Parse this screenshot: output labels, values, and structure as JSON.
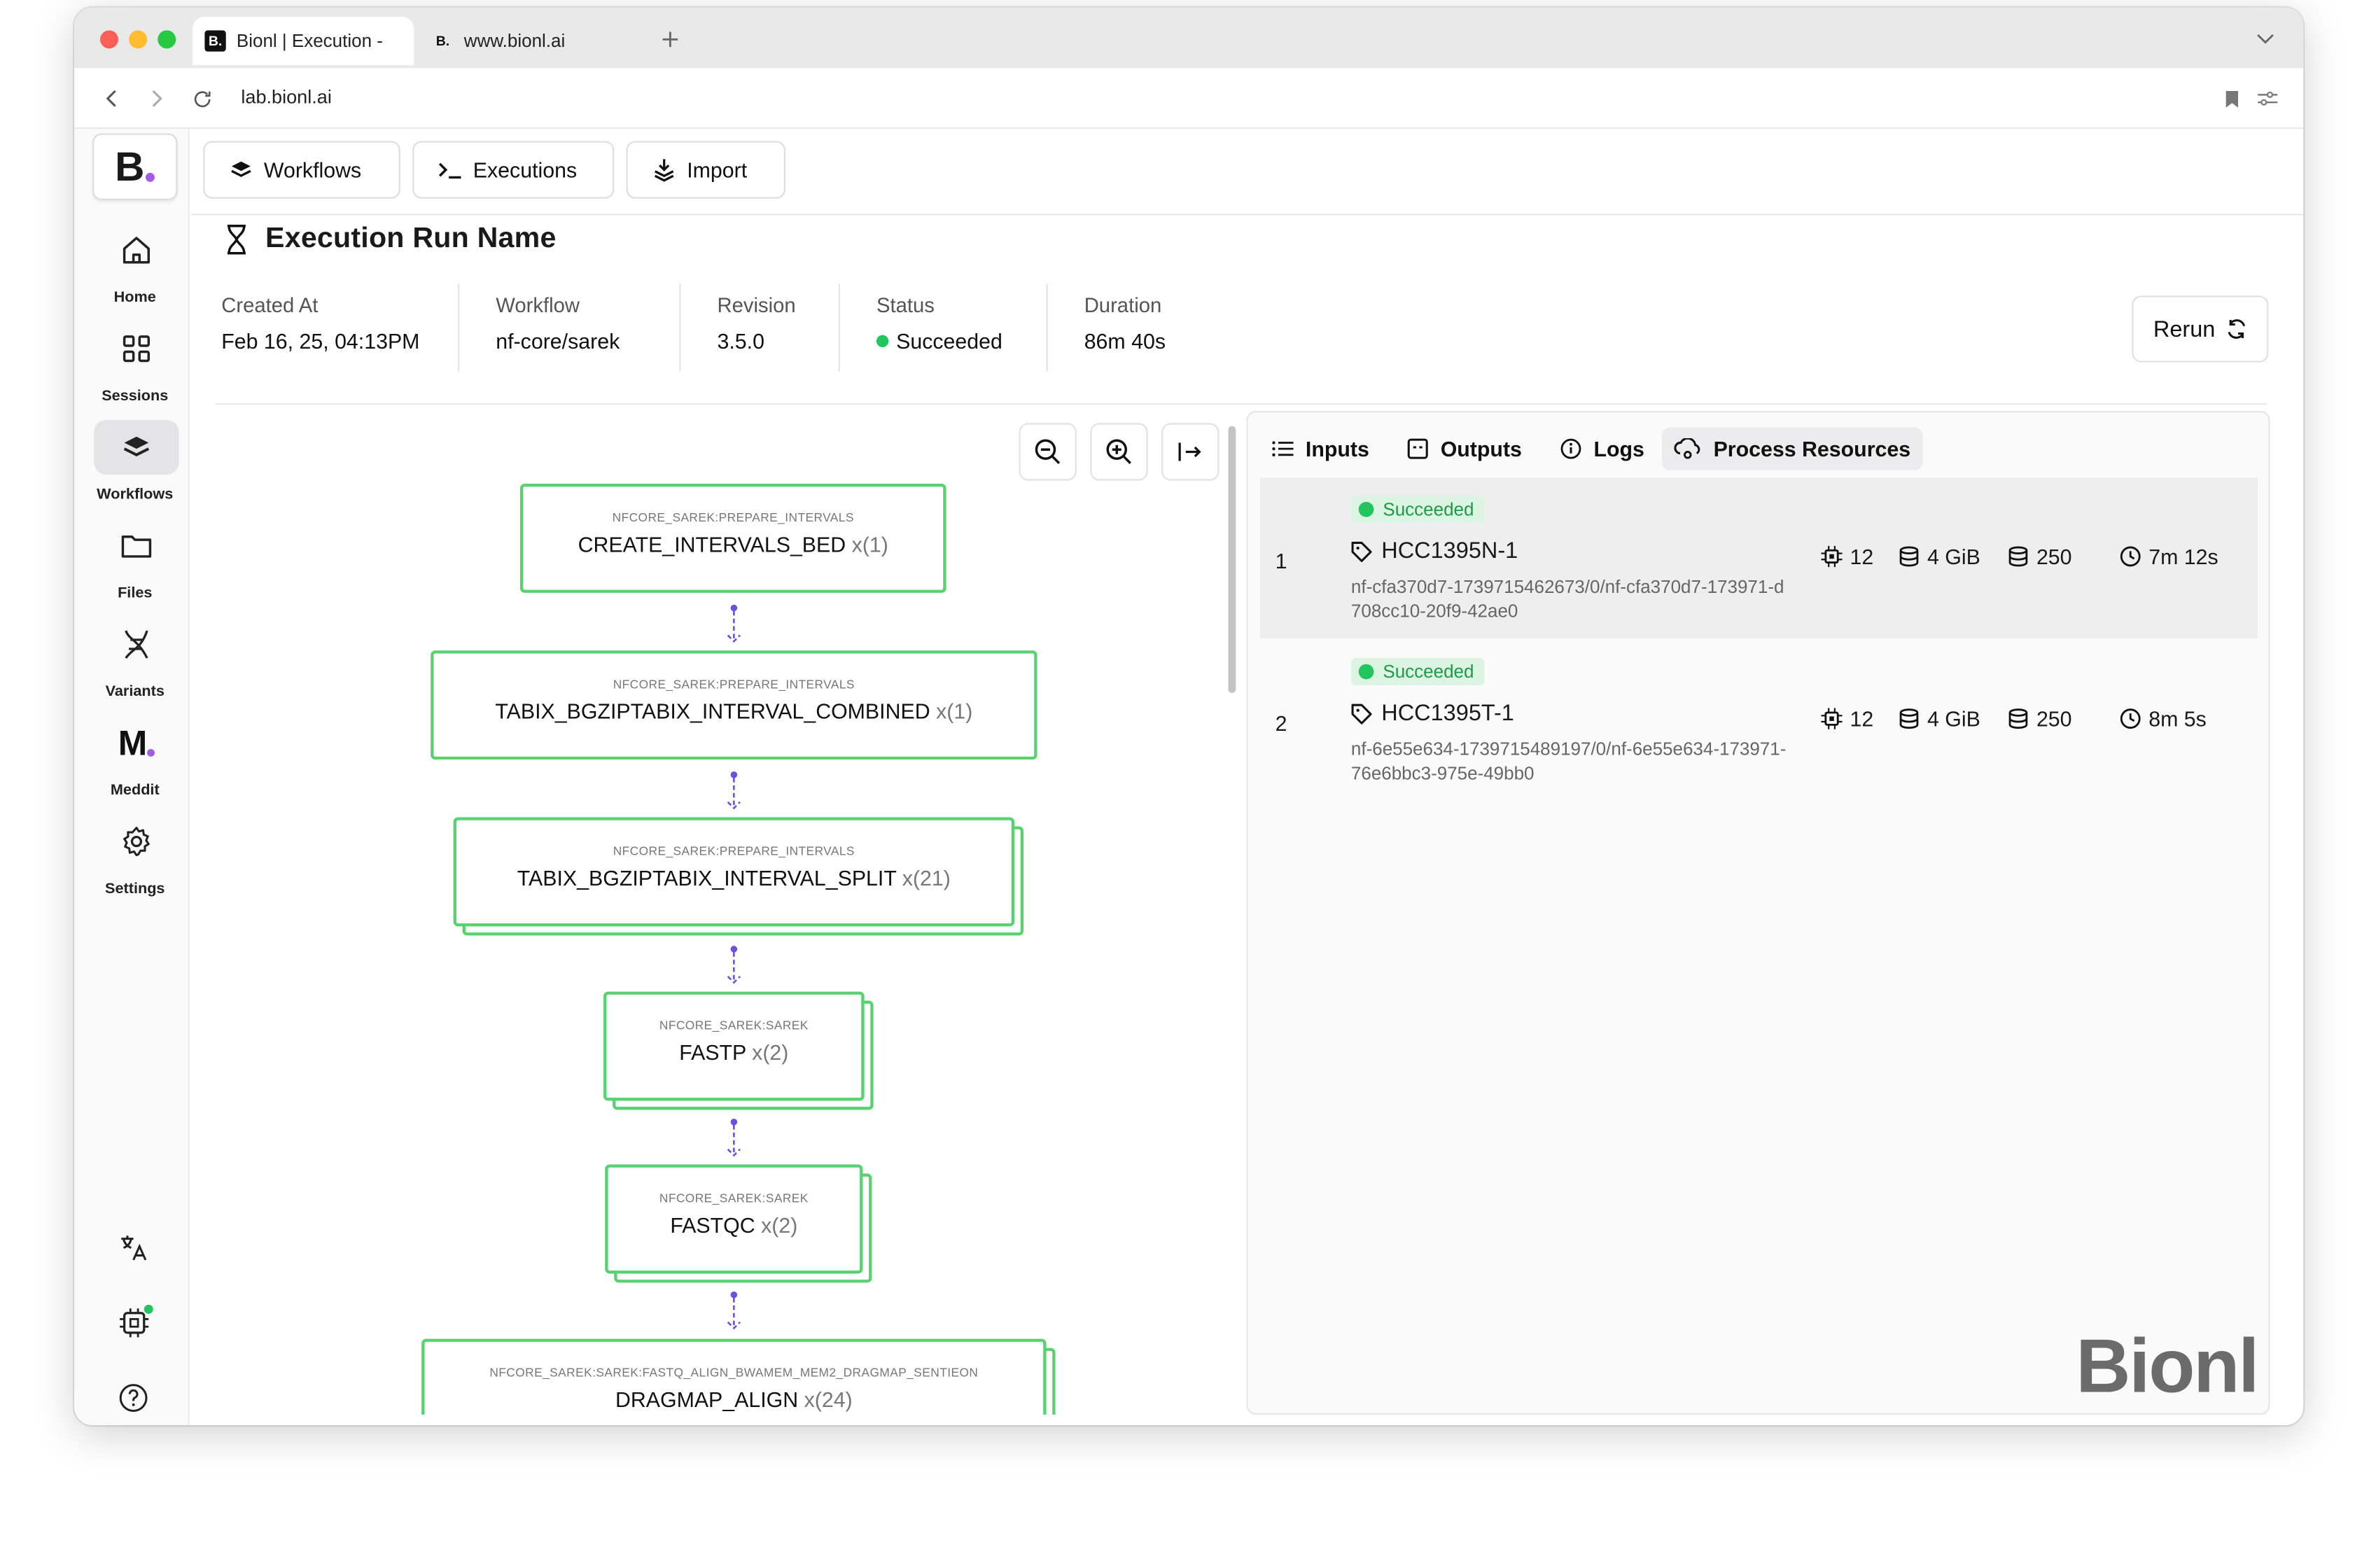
{
  "browser": {
    "tabs": [
      {
        "favicon": "B.",
        "label": "Bionl | Execution -"
      },
      {
        "favicon": "B.",
        "label": "www.bionl.ai"
      }
    ],
    "url": "lab.bionl.ai"
  },
  "sidebar": {
    "logo": "B.",
    "items": [
      {
        "label": "Home",
        "icon": "home-icon"
      },
      {
        "label": "Sessions",
        "icon": "grid-icon"
      },
      {
        "label": "Workflows",
        "icon": "layers-icon"
      },
      {
        "label": "Files",
        "icon": "folder-icon"
      },
      {
        "label": "Variants",
        "icon": "dna-icon"
      },
      {
        "label": "Meddit",
        "icon": "meddit-logo-icon"
      },
      {
        "label": "Settings",
        "icon": "gear-icon"
      }
    ]
  },
  "toolbar": {
    "workflows": "Workflows",
    "executions": "Executions",
    "import": "Import"
  },
  "execution": {
    "title": "Execution Run Name",
    "meta": [
      {
        "label": "Created At",
        "value": "Feb 16, 25, 04:13PM"
      },
      {
        "label": "Workflow",
        "value": "nf-core/sarek"
      },
      {
        "label": "Revision",
        "value": "3.5.0"
      },
      {
        "label": "Status",
        "value": "Succeeded"
      },
      {
        "label": "Duration",
        "value": "86m 40s"
      }
    ],
    "rerun": "Rerun"
  },
  "dag": {
    "nodes": [
      {
        "scope": "NFCORE_SAREK:PREPARE_INTERVALS",
        "name": "CREATE_INTERVALS_BED",
        "count": "x(1)"
      },
      {
        "scope": "NFCORE_SAREK:PREPARE_INTERVALS",
        "name": "TABIX_BGZIPTABIX_INTERVAL_COMBINED",
        "count": "x(1)"
      },
      {
        "scope": "NFCORE_SAREK:PREPARE_INTERVALS",
        "name": "TABIX_BGZIPTABIX_INTERVAL_SPLIT",
        "count": "x(21)"
      },
      {
        "scope": "NFCORE_SAREK:SAREK",
        "name": "FASTP",
        "count": "x(2)"
      },
      {
        "scope": "NFCORE_SAREK:SAREK",
        "name": "FASTQC",
        "count": "x(2)"
      },
      {
        "scope": "NFCORE_SAREK:SAREK:FASTQ_ALIGN_BWAMEM_MEM2_DRAGMAP_SENTIEON",
        "name": "DRAGMAP_ALIGN",
        "count": "x(24)"
      }
    ]
  },
  "panel": {
    "tabs": [
      {
        "label": "Inputs",
        "icon": "list-icon"
      },
      {
        "label": "Outputs",
        "icon": "box-icon"
      },
      {
        "label": "Logs",
        "icon": "info-icon"
      },
      {
        "label": "Process Resources",
        "icon": "cloud-cog-icon"
      }
    ],
    "rows": [
      {
        "index": "1",
        "status": "Succeeded",
        "name": "HCC1395N-1",
        "id": "nf-cfa370d7-1739715462673/0/nf-cfa370d7-173971-d708cc10-20f9-42ae0",
        "cpus": "12",
        "memory": "4 GiB",
        "disk": "250",
        "time": "7m 12s"
      },
      {
        "index": "2",
        "status": "Succeeded",
        "name": "HCC1395T-1",
        "id": "nf-6e55e634-1739715489197/0/nf-6e55e634-173971-76e6bbc3-975e-49bb0",
        "cpus": "12",
        "memory": "4 GiB",
        "disk": "250",
        "time": "8m 5s"
      }
    ],
    "watermark": "Bionl"
  },
  "colors": {
    "node_border": "#57d26f",
    "edge": "#6c4fe0",
    "success": "#22c55e",
    "accent_dot": "#a05ce8"
  }
}
